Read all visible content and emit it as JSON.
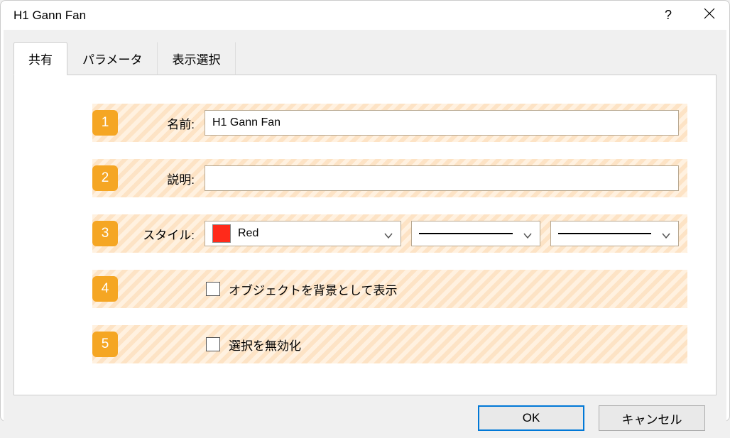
{
  "titlebar": {
    "title": "H1 Gann Fan"
  },
  "tabs": [
    {
      "label": "共有",
      "active": true
    },
    {
      "label": "パラメータ",
      "active": false
    },
    {
      "label": "表示選択",
      "active": false
    }
  ],
  "rows": {
    "1": {
      "number": "1",
      "label": "名前:",
      "value": "H1 Gann Fan"
    },
    "2": {
      "number": "2",
      "label": "説明:",
      "value": ""
    },
    "3": {
      "number": "3",
      "label": "スタイル:",
      "color_name": "Red",
      "color_hex": "#ff2a1a"
    },
    "4": {
      "number": "4",
      "checkbox_label": "オブジェクトを背景として表示",
      "checked": false
    },
    "5": {
      "number": "5",
      "checkbox_label": "選択を無効化",
      "checked": false
    }
  },
  "buttons": {
    "ok": "OK",
    "cancel": "キャンセル"
  }
}
